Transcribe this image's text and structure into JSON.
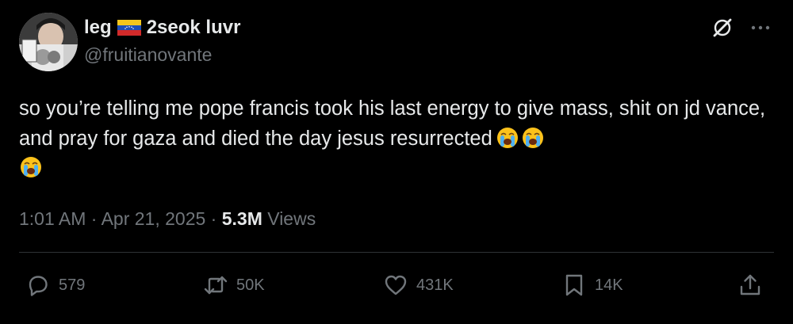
{
  "author": {
    "display_name": "leg",
    "display_name_suffix": "2seok luvr",
    "handle": "@fruitianovante",
    "flag_emoji": "venezuela-flag"
  },
  "tweet": {
    "text": "so you’re telling me pope francis took his last energy to give mass, shit on jd vance, and pray for gaza and died the day jesus resurrected",
    "emoji": "loudly-crying-face"
  },
  "meta": {
    "time": "1:01 AM",
    "separator": " · ",
    "date": "Apr 21, 2025",
    "views_count": "5.3M",
    "views_label": "Views"
  },
  "actions": {
    "replies": "579",
    "reposts": "50K",
    "likes": "431K",
    "bookmarks": "14K"
  },
  "colors": {
    "background": "#000000",
    "text": "#e7e9ea",
    "secondary": "#71767b",
    "divider": "#2f3336"
  }
}
